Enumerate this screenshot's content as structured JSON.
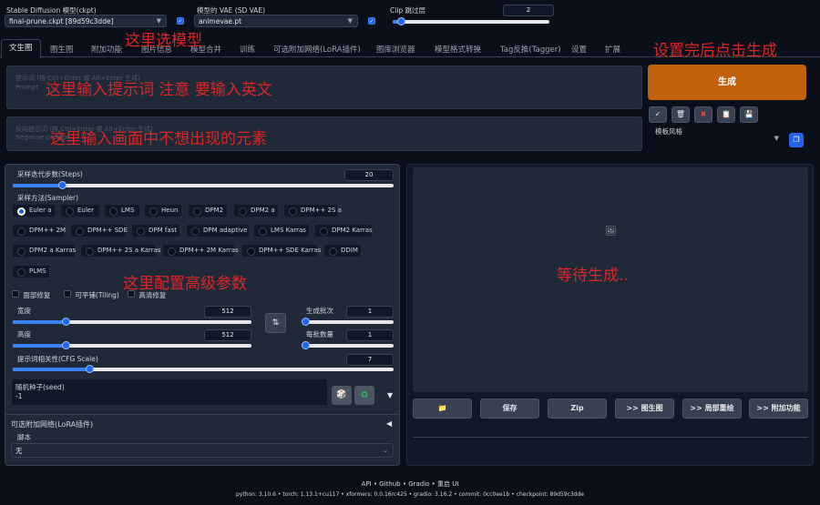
{
  "top": {
    "model_label": "Stable Diffusion 模型(ckpt)",
    "model_value": "final-prune.ckpt [89d59c3dde]",
    "vae_label": "模型的 VAE (SD VAE)",
    "vae_value": "animevae.pt",
    "clip_label": "Clip 跳过层",
    "clip_value": "2",
    "clip_fraction": 0.05
  },
  "tabs": [
    "文生图",
    "图生图",
    "附加功能",
    "图片信息",
    "模型合并",
    "训练",
    "可选附加网络(LoRA插件)",
    "图库浏览器",
    "模型格式转换",
    "Tag反推(Tagger)",
    "设置",
    "扩展"
  ],
  "prompt": {
    "placeholder1": "提示词 (按 Ctrl+Enter 或 Alt+Enter 生成)",
    "placeholder2": "Prompt",
    "neg_placeholder1": "反向提示词 (按 Ctrl+Enter 或 Alt+Enter 生成)",
    "neg_placeholder2": "Negative prompt"
  },
  "generate_label": "生成",
  "tool_icons": [
    "✓",
    "🗑",
    "✖",
    "📋",
    "💾"
  ],
  "style": {
    "label": "模板风格",
    "apply_icon": "❐"
  },
  "params": {
    "steps_label": "采样迭代步数(Steps)",
    "steps_value": "20",
    "steps_fraction": 0.13,
    "sampler_label": "采样方法(Sampler)",
    "samplers": [
      "Euler a",
      "Euler",
      "LMS",
      "Heun",
      "DPM2",
      "DPM2 a",
      "DPM++ 2S a",
      "DPM++ 2M",
      "DPM++ SDE",
      "DPM fast",
      "DPM adaptive",
      "LMS Karras",
      "DPM2 Karras",
      "DPM2 a Karras",
      "DPM++ 2S a Karras",
      "DPM++ 2M Karras",
      "DPM++ SDE Karras",
      "DDIM",
      "PLMS"
    ],
    "selected_sampler": "Euler a",
    "face_fix": "面部修复",
    "tiling": "可平铺(Tiling)",
    "hires": "高清修复",
    "width_label": "宽度",
    "width_value": "512",
    "width_fraction": 0.22,
    "height_label": "高度",
    "height_value": "512",
    "height_fraction": 0.22,
    "swap_icon": "⇅",
    "batch_count_label": "生成批次",
    "batch_count_value": "1",
    "batch_size_label": "每批数量",
    "batch_size_value": "1",
    "cfg_label": "提示词相关性(CFG Scale)",
    "cfg_value": "7",
    "cfg_fraction": 0.2,
    "seed_label": "随机种子(seed)",
    "seed_value": "-1",
    "seed_dice_icon": "🎲",
    "seed_recycle_icon": "♻",
    "seed_extra_icon": "▼",
    "lora_label": "可选附加网络(LoRA插件)",
    "lora_toggle_icon": "◀",
    "script_label": "脚本",
    "script_value": "无"
  },
  "output": {
    "image_icon": "🖼",
    "folder_icon": "📁",
    "save": "保存",
    "zip": "Zip",
    "to_img2img": ">> 图生图",
    "to_inpaint": ">> 局部重绘",
    "to_extras": ">> 附加功能"
  },
  "annotations": {
    "model": "这里选模型",
    "generate": "设置完后点击生成",
    "prompt": "这里输入提示词 注意   要输入英文",
    "negative": "这里输入画面中不想出现的元素",
    "params": "这里配置高级参数",
    "waiting": "等待生成.."
  },
  "footer": {
    "links": "API  •  Github  •  Gradio  •  重启 UI",
    "versions": "python: 3.10.6  •  torch: 1.13.1+cu117  •  xformers: 0.0.16rc425  •  gradio: 3.16.2  •  commit: 0cc0ee1b  •  checkpoint: 89d59c3dde"
  },
  "colors": {
    "accent": "#2563eb",
    "generate": "#c2620c",
    "annotation": "#dc2626"
  }
}
